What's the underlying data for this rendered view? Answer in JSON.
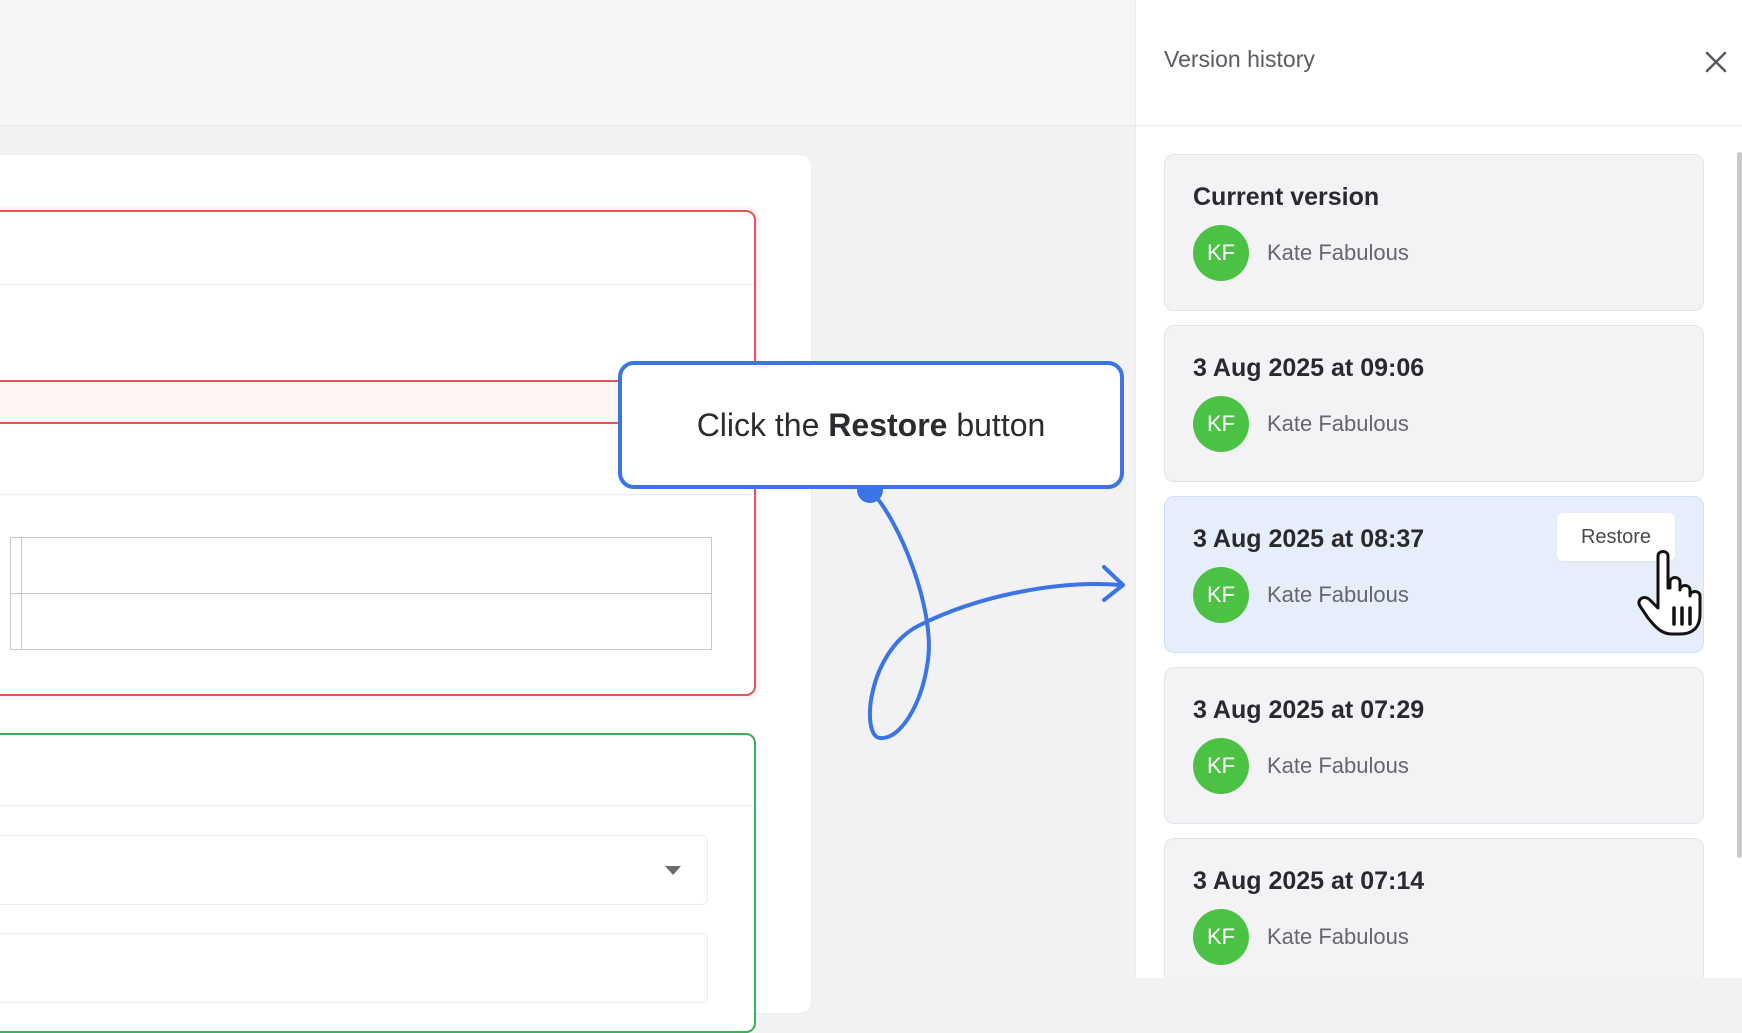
{
  "callout": {
    "prefix": "Click the ",
    "emphasis": "Restore",
    "suffix": " button"
  },
  "panel": {
    "title": "Version history",
    "close_icon": "close-icon"
  },
  "versions": [
    {
      "title": "Current version",
      "initials": "KF",
      "author": "Kate Fabulous"
    },
    {
      "title": "3 Aug 2025 at 09:06",
      "initials": "KF",
      "author": "Kate Fabulous"
    },
    {
      "title": "3 Aug 2025 at 08:37",
      "initials": "KF",
      "author": "Kate Fabulous",
      "selected": true,
      "action": "Restore"
    },
    {
      "title": "3 Aug 2025 at 07:29",
      "initials": "KF",
      "author": "Kate Fabulous"
    },
    {
      "title": "3 Aug 2025 at 07:14",
      "initials": "KF",
      "author": "Kate Fabulous"
    }
  ],
  "colors": {
    "accent": "#3b74e6",
    "avatar": "#4cc244",
    "error_border": "#e05555",
    "success_border": "#3cae5c",
    "selected_card": "#e6eefb"
  }
}
